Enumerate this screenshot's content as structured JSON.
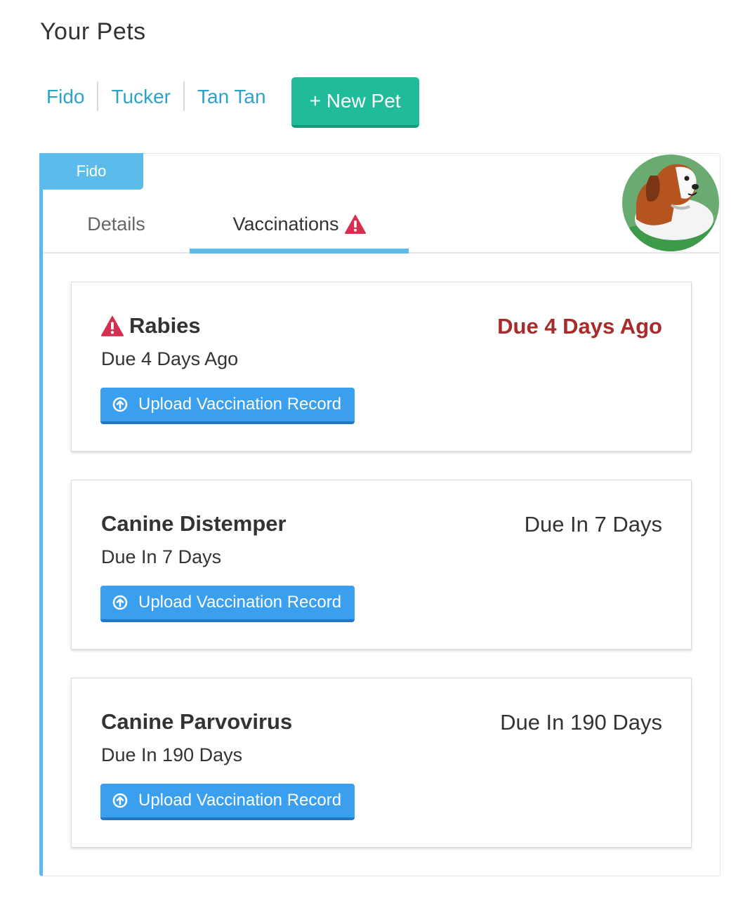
{
  "page": {
    "title": "Your Pets"
  },
  "pets_nav": {
    "pets": [
      {
        "name": "Fido"
      },
      {
        "name": "Tucker"
      },
      {
        "name": "Tan Tan"
      }
    ],
    "new_pet_label": "+ New Pet"
  },
  "pet_panel": {
    "pet_name": "Fido",
    "tabs": [
      {
        "label": "Details",
        "active": false
      },
      {
        "label": "Vaccinations",
        "active": true,
        "icon": "warning-icon"
      }
    ],
    "vaccinations": [
      {
        "name": "Rabies",
        "status": "Due 4 Days Ago",
        "due_label": "Due 4 Days Ago",
        "overdue": true,
        "icon": "warning-icon",
        "upload_label": "Upload Vaccination Record"
      },
      {
        "name": "Canine Distemper",
        "status": "Due In 7 Days",
        "due_label": "Due In 7 Days",
        "overdue": false,
        "upload_label": "Upload Vaccination Record"
      },
      {
        "name": "Canine Parvovirus",
        "status": "Due In 190 Days",
        "due_label": "Due In 190 Days",
        "overdue": false,
        "upload_label": "Upload Vaccination Record"
      }
    ]
  },
  "colors": {
    "link": "#2ea3c8",
    "new_pet_button": "#1fbb9a",
    "accent": "#5bbcec",
    "upload_button": "#3a9fef",
    "overdue_text": "#a82a2a",
    "warning_icon": "#d63050"
  }
}
